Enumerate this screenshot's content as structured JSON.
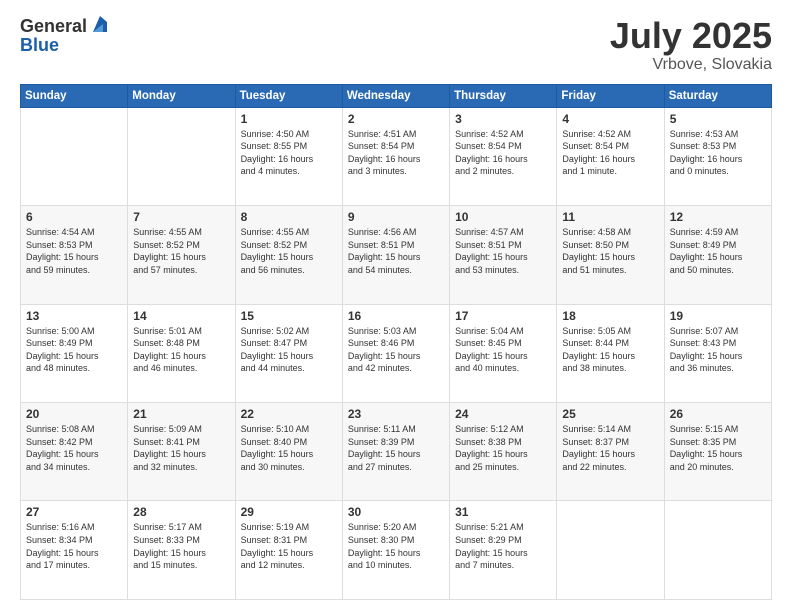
{
  "header": {
    "logo_general": "General",
    "logo_blue": "Blue",
    "title": "July 2025",
    "location": "Vrbove, Slovakia"
  },
  "days_of_week": [
    "Sunday",
    "Monday",
    "Tuesday",
    "Wednesday",
    "Thursday",
    "Friday",
    "Saturday"
  ],
  "weeks": [
    [
      {
        "day": "",
        "info": ""
      },
      {
        "day": "",
        "info": ""
      },
      {
        "day": "1",
        "info": "Sunrise: 4:50 AM\nSunset: 8:55 PM\nDaylight: 16 hours\nand 4 minutes."
      },
      {
        "day": "2",
        "info": "Sunrise: 4:51 AM\nSunset: 8:54 PM\nDaylight: 16 hours\nand 3 minutes."
      },
      {
        "day": "3",
        "info": "Sunrise: 4:52 AM\nSunset: 8:54 PM\nDaylight: 16 hours\nand 2 minutes."
      },
      {
        "day": "4",
        "info": "Sunrise: 4:52 AM\nSunset: 8:54 PM\nDaylight: 16 hours\nand 1 minute."
      },
      {
        "day": "5",
        "info": "Sunrise: 4:53 AM\nSunset: 8:53 PM\nDaylight: 16 hours\nand 0 minutes."
      }
    ],
    [
      {
        "day": "6",
        "info": "Sunrise: 4:54 AM\nSunset: 8:53 PM\nDaylight: 15 hours\nand 59 minutes."
      },
      {
        "day": "7",
        "info": "Sunrise: 4:55 AM\nSunset: 8:52 PM\nDaylight: 15 hours\nand 57 minutes."
      },
      {
        "day": "8",
        "info": "Sunrise: 4:55 AM\nSunset: 8:52 PM\nDaylight: 15 hours\nand 56 minutes."
      },
      {
        "day": "9",
        "info": "Sunrise: 4:56 AM\nSunset: 8:51 PM\nDaylight: 15 hours\nand 54 minutes."
      },
      {
        "day": "10",
        "info": "Sunrise: 4:57 AM\nSunset: 8:51 PM\nDaylight: 15 hours\nand 53 minutes."
      },
      {
        "day": "11",
        "info": "Sunrise: 4:58 AM\nSunset: 8:50 PM\nDaylight: 15 hours\nand 51 minutes."
      },
      {
        "day": "12",
        "info": "Sunrise: 4:59 AM\nSunset: 8:49 PM\nDaylight: 15 hours\nand 50 minutes."
      }
    ],
    [
      {
        "day": "13",
        "info": "Sunrise: 5:00 AM\nSunset: 8:49 PM\nDaylight: 15 hours\nand 48 minutes."
      },
      {
        "day": "14",
        "info": "Sunrise: 5:01 AM\nSunset: 8:48 PM\nDaylight: 15 hours\nand 46 minutes."
      },
      {
        "day": "15",
        "info": "Sunrise: 5:02 AM\nSunset: 8:47 PM\nDaylight: 15 hours\nand 44 minutes."
      },
      {
        "day": "16",
        "info": "Sunrise: 5:03 AM\nSunset: 8:46 PM\nDaylight: 15 hours\nand 42 minutes."
      },
      {
        "day": "17",
        "info": "Sunrise: 5:04 AM\nSunset: 8:45 PM\nDaylight: 15 hours\nand 40 minutes."
      },
      {
        "day": "18",
        "info": "Sunrise: 5:05 AM\nSunset: 8:44 PM\nDaylight: 15 hours\nand 38 minutes."
      },
      {
        "day": "19",
        "info": "Sunrise: 5:07 AM\nSunset: 8:43 PM\nDaylight: 15 hours\nand 36 minutes."
      }
    ],
    [
      {
        "day": "20",
        "info": "Sunrise: 5:08 AM\nSunset: 8:42 PM\nDaylight: 15 hours\nand 34 minutes."
      },
      {
        "day": "21",
        "info": "Sunrise: 5:09 AM\nSunset: 8:41 PM\nDaylight: 15 hours\nand 32 minutes."
      },
      {
        "day": "22",
        "info": "Sunrise: 5:10 AM\nSunset: 8:40 PM\nDaylight: 15 hours\nand 30 minutes."
      },
      {
        "day": "23",
        "info": "Sunrise: 5:11 AM\nSunset: 8:39 PM\nDaylight: 15 hours\nand 27 minutes."
      },
      {
        "day": "24",
        "info": "Sunrise: 5:12 AM\nSunset: 8:38 PM\nDaylight: 15 hours\nand 25 minutes."
      },
      {
        "day": "25",
        "info": "Sunrise: 5:14 AM\nSunset: 8:37 PM\nDaylight: 15 hours\nand 22 minutes."
      },
      {
        "day": "26",
        "info": "Sunrise: 5:15 AM\nSunset: 8:35 PM\nDaylight: 15 hours\nand 20 minutes."
      }
    ],
    [
      {
        "day": "27",
        "info": "Sunrise: 5:16 AM\nSunset: 8:34 PM\nDaylight: 15 hours\nand 17 minutes."
      },
      {
        "day": "28",
        "info": "Sunrise: 5:17 AM\nSunset: 8:33 PM\nDaylight: 15 hours\nand 15 minutes."
      },
      {
        "day": "29",
        "info": "Sunrise: 5:19 AM\nSunset: 8:31 PM\nDaylight: 15 hours\nand 12 minutes."
      },
      {
        "day": "30",
        "info": "Sunrise: 5:20 AM\nSunset: 8:30 PM\nDaylight: 15 hours\nand 10 minutes."
      },
      {
        "day": "31",
        "info": "Sunrise: 5:21 AM\nSunset: 8:29 PM\nDaylight: 15 hours\nand 7 minutes."
      },
      {
        "day": "",
        "info": ""
      },
      {
        "day": "",
        "info": ""
      }
    ]
  ]
}
